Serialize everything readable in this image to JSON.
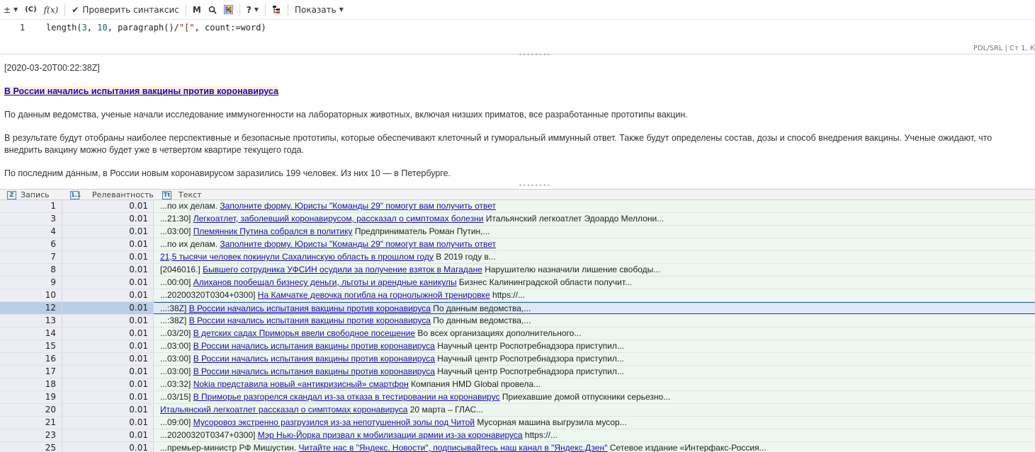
{
  "toolbar": {
    "plusminus": "±",
    "c_label": "(C)",
    "fx_label": "f(x)",
    "check_syntax": "Проверить синтаксис",
    "m_label": "M",
    "help_label": "?",
    "show_label": "Показать"
  },
  "editor": {
    "line_number": "1",
    "code_prefix": "length(",
    "code_num1": "3",
    "code_sep1": ", ",
    "code_num2": "10",
    "code_mid": ", paragraph()/",
    "code_str": "\"[\"",
    "code_suffix": ", count:=word)",
    "status": "PDL/SRL | Ст 1, К"
  },
  "document": {
    "timestamp": "[2020-03-20T00:22:38Z]",
    "title": "В России начались испытания вакцины против коронавируса",
    "p1": "По данным ведомства, ученые начали исследование иммуногенности на лабораторных животных, включая низших приматов, все разработанные прототипы вакцин.",
    "p2": "В результате будут отобраны наиболее перспективные и безопасные прототипы, которые обеспечивают клеточный и гуморальный иммунный ответ. Также будут определены состав, дозы и способ внедрения вакцины. Ученые ожидают, что внедрить вакцину можно будет уже в четвертом квартире текущего года.",
    "p3": "По последним данным, в России новым коронавирусом заразились 199 человек. Из них 10 — в Петербурге."
  },
  "grid": {
    "columns": [
      {
        "label": "Запись",
        "icon": "Z"
      },
      {
        "label": "Релевантность",
        "icon": "1.1"
      },
      {
        "label": "Текст",
        "icon": "Tt"
      }
    ],
    "rows": [
      {
        "id": "1",
        "rel": "0.01",
        "pre": "...по их делам. ",
        "link": "Заполните форму. Юристы \"Команды 29\" помогут вам получить ответ",
        "post": ""
      },
      {
        "id": "3",
        "rel": "0.01",
        "pre": "...21:30] ",
        "link": "Легкоатлет, заболевший коронавирусом, рассказал о симптомах болезни",
        "post": " Итальянский легкоатлет Эдоардо Меллони..."
      },
      {
        "id": "4",
        "rel": "0.01",
        "pre": "...03:00] ",
        "link": "Племянник Путина собрался в политику",
        "post": " Предприниматель Роман Путин,..."
      },
      {
        "id": "6",
        "rel": "0.01",
        "pre": "...по их делам. ",
        "link": "Заполните форму. Юристы \"Команды 29\" помогут вам получить ответ",
        "post": ""
      },
      {
        "id": "7",
        "rel": "0.01",
        "pre": "",
        "link": "21,5 тысячи человек покинули Сахалинскую область в прошлом году",
        "post": " В 2019 году в..."
      },
      {
        "id": "8",
        "rel": "0.01",
        "pre": "[2046016.] ",
        "link": "Бывшего сотрудника УФСИН осудили за получение взяток в Магадане",
        "post": " Нарушителю назначили лишение свободы..."
      },
      {
        "id": "9",
        "rel": "0.01",
        "pre": "...00:00] ",
        "link": "Алиханов пообещал бизнесу деньги, льготы и арендные каникулы",
        "post": " Бизнес Калининградской области получит..."
      },
      {
        "id": "10",
        "rel": "0.01",
        "pre": "...20200320T0304+0300] ",
        "link": "На Камчатке девочка погибла на горнолыжной тренировке",
        "post": " https://..."
      },
      {
        "id": "12",
        "rel": "0.01",
        "pre": "...:38Z] ",
        "link": "В России начались испытания вакцины против коронавируса",
        "post": " По данным ведомства,...",
        "selected": true
      },
      {
        "id": "13",
        "rel": "0.01",
        "pre": "...:38Z] ",
        "link": "В России начались испытания вакцины против коронавируса",
        "post": " По данным ведомства,..."
      },
      {
        "id": "14",
        "rel": "0.01",
        "pre": "...03/20] ",
        "link": "В детских садах Приморья ввели свободное посещение",
        "post": " Во всех организациях дополнительного..."
      },
      {
        "id": "15",
        "rel": "0.01",
        "pre": "...03:00] ",
        "link": "В России начались испытания вакцины против коронавируса",
        "post": " Научный центр Роспотребнадзора приступил..."
      },
      {
        "id": "16",
        "rel": "0.01",
        "pre": "...03:00] ",
        "link": "В России начались испытания вакцины против коронавируса",
        "post": " Научный центр Роспотребнадзора приступил..."
      },
      {
        "id": "17",
        "rel": "0.01",
        "pre": "...03:00] ",
        "link": "В России начались испытания вакцины против коронавируса",
        "post": " Научный центр Роспотребнадзора приступил..."
      },
      {
        "id": "18",
        "rel": "0.01",
        "pre": "...03:32] ",
        "link": "Nokia представила новый «антикризисный» смартфон",
        "post": " Компания HMD Global провела..."
      },
      {
        "id": "19",
        "rel": "0.01",
        "pre": "...03/15] ",
        "link": "В Приморье разгорелся скандал из-за отказа в тестировании на коронавирус",
        "post": " Приехавшие домой отпускники серьезно..."
      },
      {
        "id": "20",
        "rel": "0.01",
        "pre": "",
        "link": "Итальянский легкоатлет рассказал о симптомах коронавируса",
        "post": " 20 марта – ГЛАС..."
      },
      {
        "id": "21",
        "rel": "0.01",
        "pre": "...09:00] ",
        "link": "Мусоровоз экстренно разгрузился из-за непотушенной золы под Читой",
        "post": " Мусорная машина выгрузила мусор..."
      },
      {
        "id": "23",
        "rel": "0.01",
        "pre": "...20200320T0347+0300] ",
        "link": "Мэр Нью-Йорка призвал к мобилизации армии из-за коронавируса",
        "post": " https://..."
      },
      {
        "id": "25",
        "rel": "0.01",
        "pre": "...премьер-министр РФ Мишустин. ",
        "link": "Читайте нас в \"Яндекс. Новости\", подписывайтесь наш канал в \"Яндекс.Дзен\"",
        "post": " Сетевое издание «Интерфакс-Россия..."
      }
    ]
  }
}
